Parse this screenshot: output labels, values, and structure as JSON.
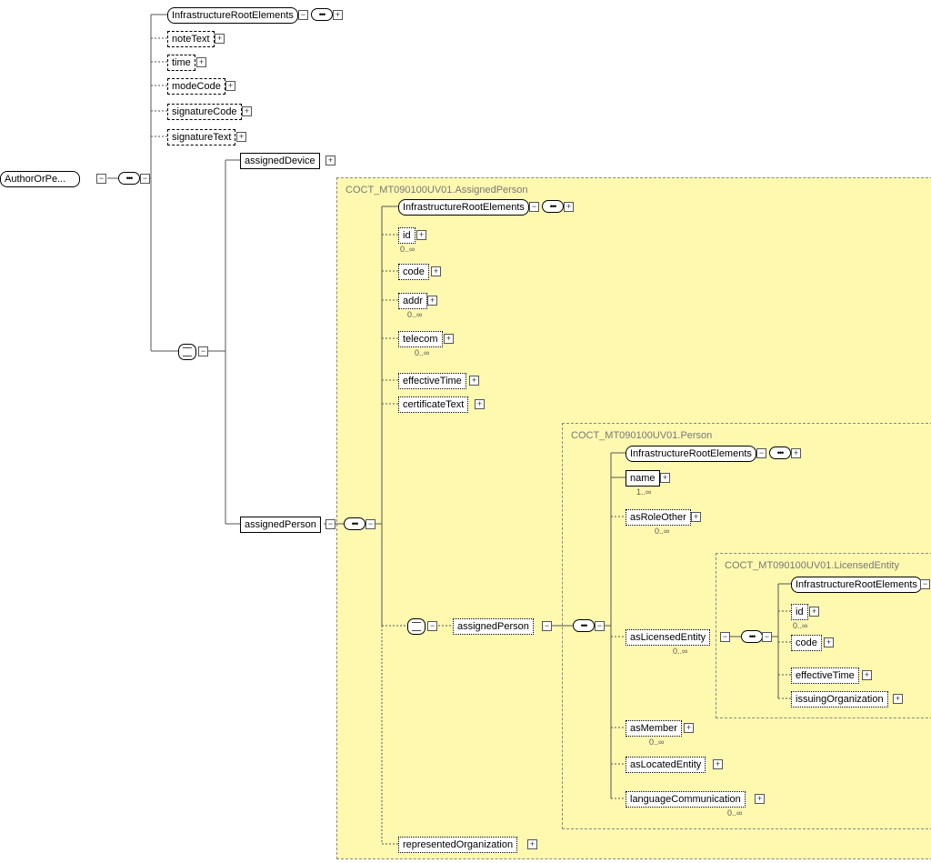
{
  "root": "AuthorOrPe...",
  "attrs": {
    "infra": "InfrastructureRootElements",
    "noteText": "noteText",
    "time": "time",
    "modeCode": "modeCode",
    "sigCode": "signatureCode",
    "sigText": "signatureText"
  },
  "choice1": {
    "assignedDevice": "assignedDevice",
    "assignedPerson": "assignedPerson"
  },
  "region1": {
    "title": "COCT_MT090100UV01.AssignedPerson",
    "infra": "InfrastructureRootElements",
    "id": "id",
    "code": "code",
    "addr": "addr",
    "telecom": "telecom",
    "effTime": "effectiveTime",
    "certText": "certificateText",
    "assignedPersonInner": "assignedPerson",
    "repOrg": "representedOrganization"
  },
  "region2": {
    "title": "COCT_MT090100UV01.Person",
    "infra": "InfrastructureRootElements",
    "name": "name",
    "asRoleOther": "asRoleOther",
    "asLicensed": "asLicensedEntity",
    "asMember": "asMember",
    "asLocated": "asLocatedEntity",
    "langComm": "languageCommunication"
  },
  "region3": {
    "title": "COCT_MT090100UV01.LicensedEntity",
    "infra": "InfrastructureRootElements",
    "id": "id",
    "code": "code",
    "effTime": "effectiveTime",
    "issuingOrg": "issuingOrganization"
  },
  "cardinality": {
    "zeroInf": "0..∞",
    "oneInf": "1..∞"
  },
  "glyph": {
    "plus": "+",
    "minus": "−",
    "seq": "•••"
  }
}
